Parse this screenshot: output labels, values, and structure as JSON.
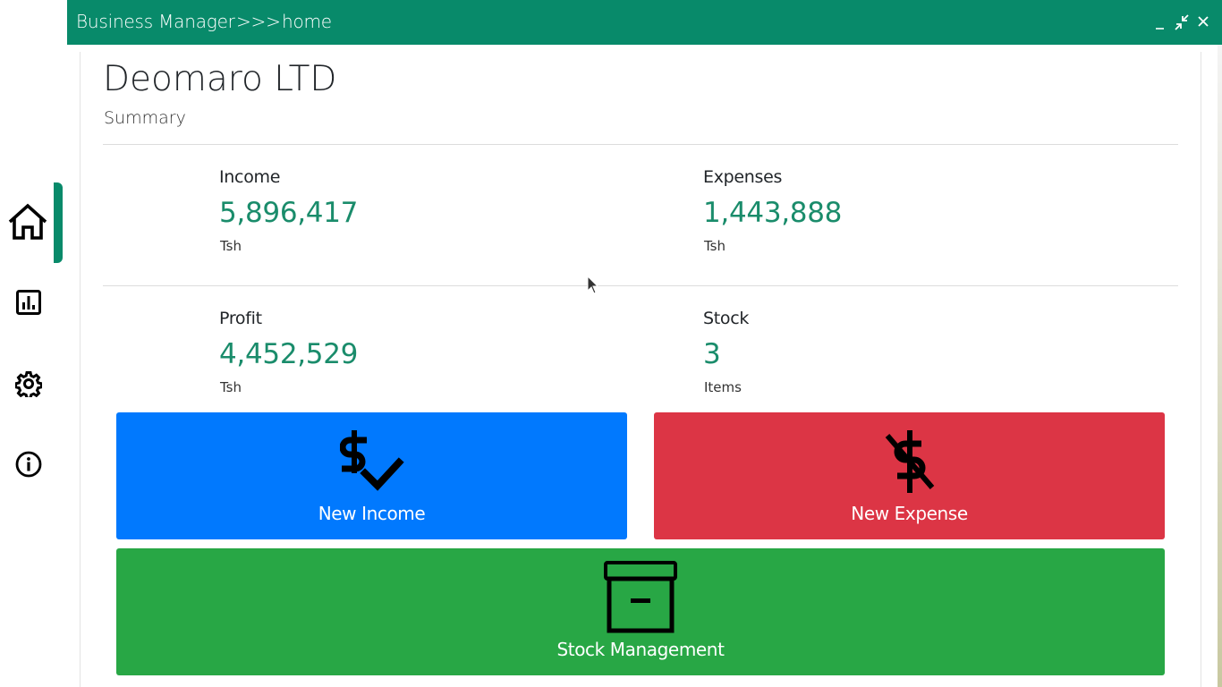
{
  "titlebar": {
    "app_name": "Business Manager",
    "separator": ">>>",
    "page": "home",
    "minimize_label": "_",
    "restore_icon": "compress-icon",
    "close_label": "✕"
  },
  "sidebar": {
    "items": [
      {
        "name": "home",
        "icon": "home-icon",
        "active": true
      },
      {
        "name": "reports",
        "icon": "chart-icon",
        "active": false
      },
      {
        "name": "settings",
        "icon": "gear-icon",
        "active": false
      },
      {
        "name": "about",
        "icon": "info-icon",
        "active": false
      }
    ],
    "accent": "#088a6a"
  },
  "summary": {
    "company": "Deomaro LTD",
    "subtitle": "Summary",
    "income": {
      "label": "Income",
      "value": "5,896,417",
      "unit": "Tsh"
    },
    "expenses": {
      "label": "Expenses",
      "value": "1,443,888",
      "unit": "Tsh"
    },
    "profit": {
      "label": "Profit",
      "value": "4,452,529",
      "unit": "Tsh"
    },
    "stock": {
      "label": "Stock",
      "value": "3",
      "unit": "Items"
    }
  },
  "actions": {
    "new_income": {
      "label": "New Income",
      "color": "#0179fe",
      "icon": "dollar-check-icon"
    },
    "new_expense": {
      "label": "New Expense",
      "color": "#dc3545",
      "icon": "dollar-slash-icon"
    },
    "stock_management": {
      "label": "Stock Management",
      "color": "#28a745",
      "icon": "archive-box-icon"
    }
  },
  "colors": {
    "value_green": "#1a8c6b",
    "titlebar": "#088a6a"
  }
}
